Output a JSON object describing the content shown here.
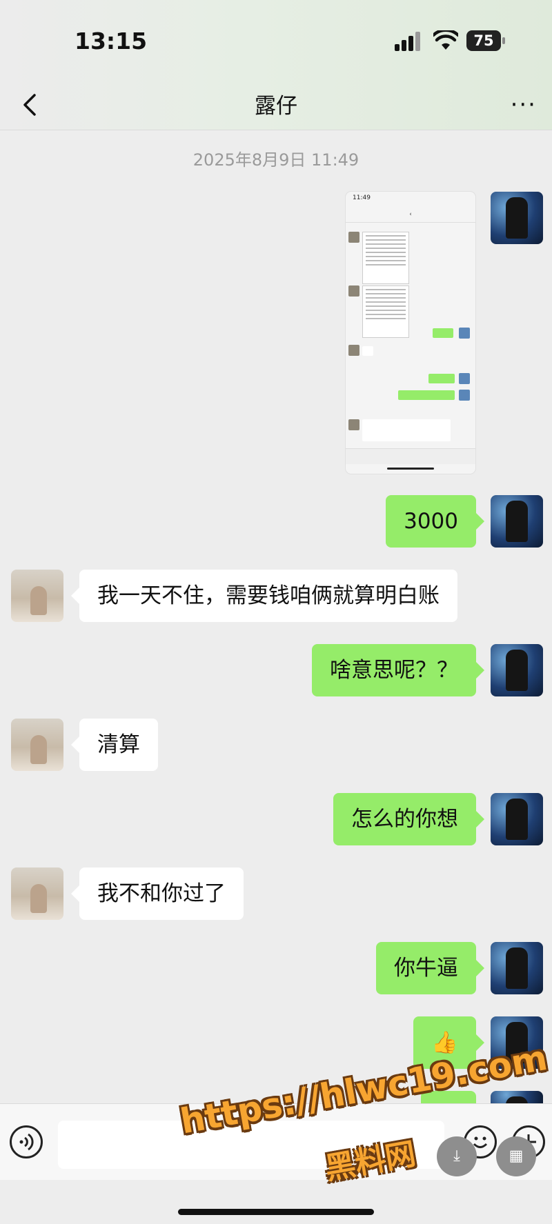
{
  "status": {
    "time": "13:15",
    "battery": "75"
  },
  "nav": {
    "title": "露仔",
    "more": "···"
  },
  "chat": {
    "timestamp": "2025年8月9日 11:49",
    "messages": [
      {
        "from": "me",
        "text": "3000"
      },
      {
        "from": "her",
        "text": "我一天不住，需要钱咱俩就算明白账"
      },
      {
        "from": "me",
        "text": "啥意思呢？？"
      },
      {
        "from": "her",
        "text": "清算"
      },
      {
        "from": "me",
        "text": "怎么的你想"
      },
      {
        "from": "her",
        "text": "我不和你过了"
      },
      {
        "from": "me",
        "text": "你牛逼"
      },
      {
        "from": "me",
        "text": "👍"
      }
    ]
  },
  "screenshot_image": {
    "time": "11:49"
  },
  "watermark": {
    "url": "https://hlwc19.com",
    "site": "黑料网"
  },
  "icons": [
    "back-icon",
    "more-icon",
    "voice-icon",
    "emoji-icon",
    "add-icon",
    "signal-icon",
    "wifi-icon",
    "battery-icon"
  ]
}
